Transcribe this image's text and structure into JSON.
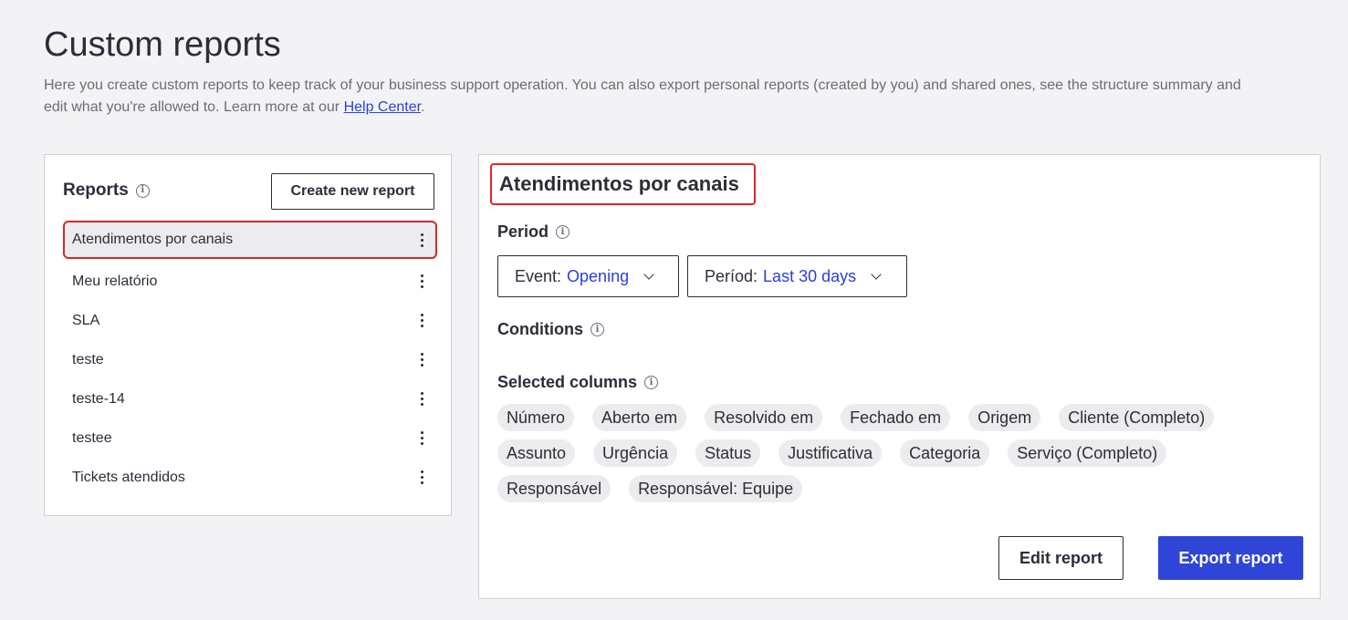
{
  "page": {
    "title": "Custom reports",
    "description": "Here you create custom reports to keep track of your business support operation. You can also export personal reports (created by you) and shared ones, see the structure summary and edit what you're allowed to. Learn more at our ",
    "help_link": "Help Center",
    "description_end": "."
  },
  "reports_panel": {
    "heading": "Reports",
    "create_button": "Create new report",
    "items": [
      {
        "label": "Atendimentos por canais",
        "active": true
      },
      {
        "label": "Meu relatório"
      },
      {
        "label": "SLA"
      },
      {
        "label": "teste"
      },
      {
        "label": "teste-14"
      },
      {
        "label": "testee"
      },
      {
        "label": "Tickets atendidos"
      }
    ]
  },
  "detail": {
    "title": "Atendimentos por canais",
    "period_label": "Period",
    "event_prefix": "Event:",
    "event_value": "Opening",
    "period_prefix": "Períod:",
    "period_value": "Last 30 days",
    "conditions_label": "Conditions",
    "columns_label": "Selected columns",
    "columns": [
      "Número",
      "Aberto em",
      "Resolvido em",
      "Fechado em",
      "Origem",
      "Cliente (Completo)",
      "Assunto",
      "Urgência",
      "Status",
      "Justificativa",
      "Categoria",
      "Serviço (Completo)",
      "Responsável",
      "Responsável: Equipe"
    ],
    "edit_button": "Edit report",
    "export_button": "Export report"
  },
  "icons": {
    "info": "info-icon",
    "kebab": "kebab-menu-icon",
    "chevron": "chevron-down-icon"
  },
  "colors": {
    "accent": "#2e45d8",
    "highlight": "#e0242b",
    "background": "#f3f3f5"
  }
}
